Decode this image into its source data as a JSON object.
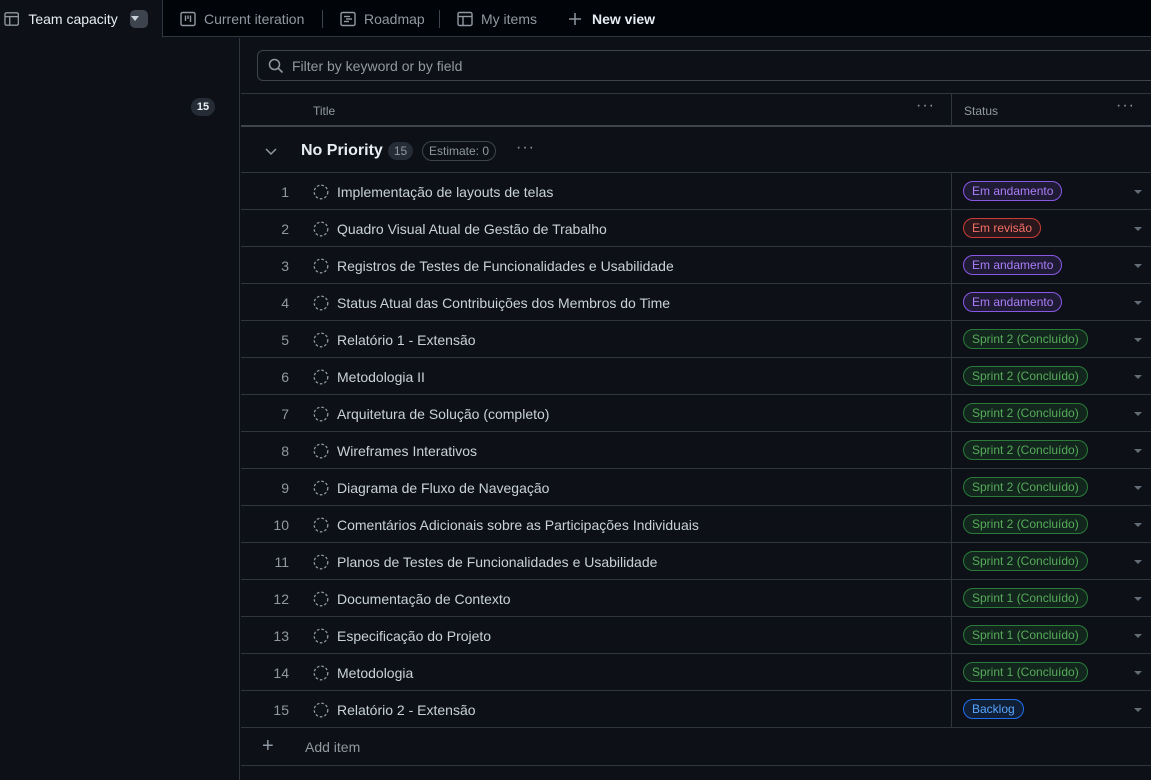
{
  "tabs": [
    {
      "label": "Team capacity",
      "icon": "table-icon",
      "active": true
    },
    {
      "label": "Current iteration",
      "icon": "board-icon"
    },
    {
      "label": "Roadmap",
      "icon": "roadmap-icon"
    },
    {
      "label": "My items",
      "icon": "table-icon"
    },
    {
      "label": "New view",
      "icon": "plus-icon"
    }
  ],
  "sidebar": {
    "count": "15"
  },
  "filter": {
    "placeholder": "Filter by keyword or by field"
  },
  "columns": {
    "title": "Title",
    "status": "Status"
  },
  "group": {
    "name": "No Priority",
    "count": "15",
    "estimate": "Estimate: 0"
  },
  "items": [
    {
      "num": "1",
      "title": "Implementação de layouts de telas",
      "status": "Em andamento",
      "color": "purple"
    },
    {
      "num": "2",
      "title": "Quadro Visual Atual de Gestão de Trabalho",
      "status": "Em revisão",
      "color": "red"
    },
    {
      "num": "3",
      "title": "Registros de Testes de Funcionalidades e Usabilidade",
      "status": "Em andamento",
      "color": "purple"
    },
    {
      "num": "4",
      "title": "Status Atual das Contribuições dos Membros do Time",
      "status": "Em andamento",
      "color": "purple"
    },
    {
      "num": "5",
      "title": "Relatório 1 - Extensão",
      "status": "Sprint 2 (Concluído)",
      "color": "green"
    },
    {
      "num": "6",
      "title": "Metodologia II",
      "status": "Sprint 2 (Concluído)",
      "color": "green"
    },
    {
      "num": "7",
      "title": "Arquitetura de Solução (completo)",
      "status": "Sprint 2 (Concluído)",
      "color": "green"
    },
    {
      "num": "8",
      "title": "Wireframes Interativos",
      "status": "Sprint 2 (Concluído)",
      "color": "green"
    },
    {
      "num": "9",
      "title": "Diagrama de Fluxo de Navegação",
      "status": "Sprint 2 (Concluído)",
      "color": "green"
    },
    {
      "num": "10",
      "title": "Comentários Adicionais sobre as Participações Individuais",
      "status": "Sprint 2 (Concluído)",
      "color": "green"
    },
    {
      "num": "11",
      "title": "Planos de Testes de Funcionalidades e Usabilidade",
      "status": "Sprint 2 (Concluído)",
      "color": "green"
    },
    {
      "num": "12",
      "title": "Documentação de Contexto",
      "status": "Sprint 1 (Concluído)",
      "color": "green"
    },
    {
      "num": "13",
      "title": "Especificação do Projeto",
      "status": "Sprint 1 (Concluído)",
      "color": "green"
    },
    {
      "num": "14",
      "title": "Metodologia",
      "status": "Sprint 1 (Concluído)",
      "color": "green"
    },
    {
      "num": "15",
      "title": "Relatório 2 - Extensão",
      "status": "Backlog",
      "color": "blue"
    }
  ],
  "add_item": {
    "label": "Add item"
  },
  "colors": {
    "purple": "#ab7df8",
    "red": "#f47067",
    "green": "#57ab5a",
    "blue": "#58a6ff",
    "background": "#0d1117"
  }
}
